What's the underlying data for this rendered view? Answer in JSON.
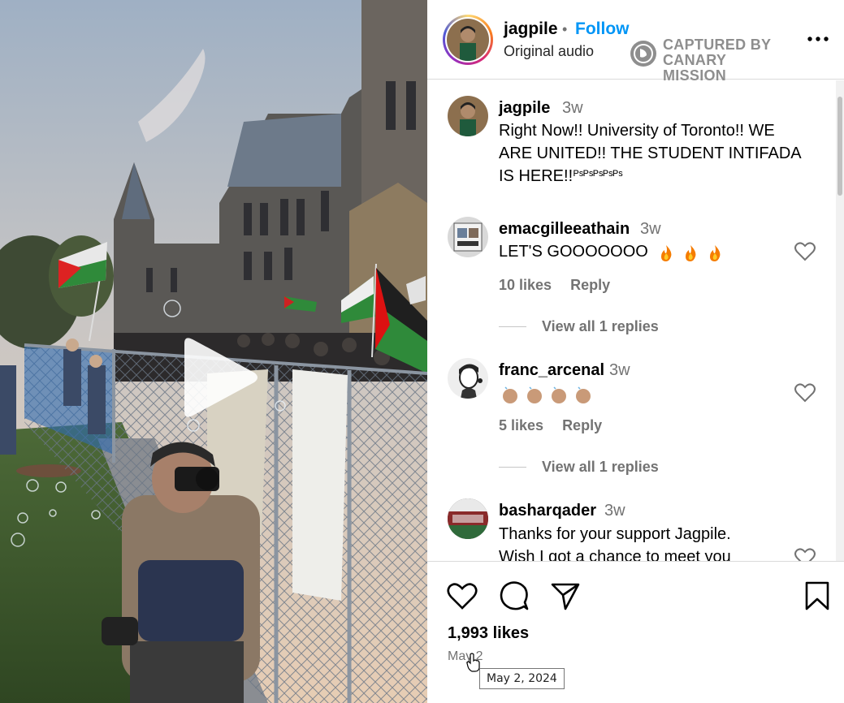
{
  "media": {
    "type": "video",
    "play_icon": "play-triangle-icon"
  },
  "post_header": {
    "username": "jagpile",
    "separator": "•",
    "follow_label": "Follow",
    "audio_label": "Original audio",
    "overlay_badge": {
      "line1": "CAPTURED BY",
      "line2": "CANARY MISSION",
      "icon": "canary-logo-icon"
    },
    "more_icon": "more-options-icon"
  },
  "caption": {
    "username": "jagpile",
    "time": "3w",
    "lines": [
      "Right Now!! University of Toronto!! WE",
      "ARE UNITED!! THE STUDENT INTIFADA",
      "IS HERE!!"
    ],
    "suffix": "ᴾˢᴾˢᴾˢᴾˢᴾˢ"
  },
  "comments": [
    {
      "username": "emacgilleeathain",
      "time": "3w",
      "text": "LET'S GOOOOOOO",
      "emojis": 3,
      "emoji_name": "fire",
      "likes": "10 likes",
      "reply_label": "Reply",
      "view_replies": "View all 1 replies"
    },
    {
      "username": "franc_arcenal",
      "time": "3w",
      "text": "",
      "emojis": 4,
      "emoji_name": "clapping-hands",
      "likes": "5 likes",
      "reply_label": "Reply",
      "view_replies": "View all 1 replies"
    },
    {
      "username": "basharqader",
      "time": "3w",
      "lines": [
        "Thanks for your support Jagpile.",
        "Wish I got a chance to meet you"
      ]
    }
  ],
  "footer": {
    "like_icon": "heart-icon",
    "comment_icon": "comment-bubble-icon",
    "share_icon": "paper-plane-icon",
    "save_icon": "bookmark-icon",
    "likes": "1,993 likes",
    "date": "May 2",
    "tooltip": "May 2, 2024"
  },
  "colors": {
    "follow": "#0095f6",
    "muted": "#737373",
    "divider": "#dbdbdb"
  }
}
